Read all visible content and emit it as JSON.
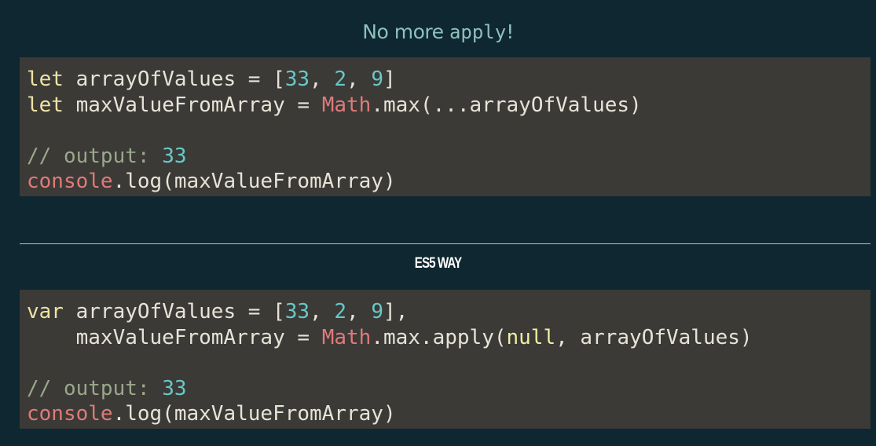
{
  "title": {
    "prefix": "No more ",
    "code": "apply",
    "suffix": "!"
  },
  "section_heading": "ES5 WAY",
  "top_code": {
    "line1": {
      "kw": "let",
      "a": " arrayOfValues = [",
      "n1": "33",
      "s1": ", ",
      "n2": "2",
      "s2": ", ",
      "n3": "9",
      "end": "]"
    },
    "line2": {
      "kw": "let",
      "a": " maxValueFromArray = ",
      "obj": "Math",
      "rest": ".max(...arrayOfValues)"
    },
    "comment_prefix": "// output: ",
    "comment_value": "33",
    "line4": {
      "obj": "console",
      "rest": ".log(maxValueFromArray)"
    }
  },
  "bottom_code": {
    "line1": {
      "kw": "var",
      "a": " arrayOfValues = [",
      "n1": "33",
      "s1": ", ",
      "n2": "2",
      "s2": ", ",
      "n3": "9",
      "end": "],"
    },
    "line2": {
      "indent": "    maxValueFromArray = ",
      "obj": "Math",
      "mid": ".max.apply(",
      "lit": "null",
      "rest": ", arrayOfValues)"
    },
    "comment_prefix": "// output: ",
    "comment_value": "33",
    "line4": {
      "obj": "console",
      "rest": ".log(maxValueFromArray)"
    }
  },
  "colors": {
    "background": "#0f2730",
    "code_background": "#3b3a37",
    "keyword": "#efe2a4",
    "number": "#68c8c6",
    "object": "#e07a7a",
    "comment": "#9aa88c",
    "title": "#8ec0bd"
  }
}
